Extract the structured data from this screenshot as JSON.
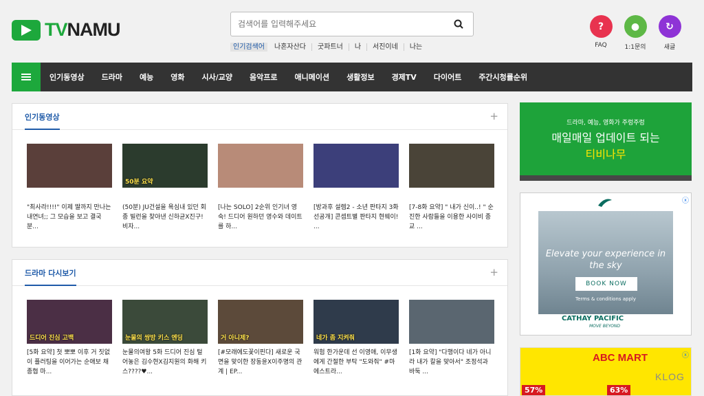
{
  "logo": {
    "tv": "TV",
    "namu": "NAMU"
  },
  "search": {
    "placeholder": "검색어를 입력해주세요"
  },
  "keywords": [
    "인기검색어",
    "나혼자산다",
    "굿파트너",
    "나",
    "서진이네",
    "나는"
  ],
  "topicons": [
    {
      "label": "FAQ",
      "color": "#e8334f",
      "icon": "question-icon",
      "glyph": "?"
    },
    {
      "label": "1:1문의",
      "color": "#5eb846",
      "icon": "chat-icon",
      "glyph": "●"
    },
    {
      "label": "새글",
      "color": "#8e33d6",
      "icon": "refresh-icon",
      "glyph": "↻"
    }
  ],
  "nav": [
    "인기동영상",
    "드라마",
    "예능",
    "영화",
    "시사/교양",
    "음악프로",
    "애니메이션",
    "생활정보",
    "경제TV",
    "다이어트",
    "주간시청률순위"
  ],
  "sections": [
    {
      "title": "인기동영상",
      "plus": "+",
      "cards": [
        {
          "title": "\"최사라!!!!\" 이제 딸까지 만나는 내연녀;; 그 모습을 보고 결국 분...",
          "caption": "",
          "bg": "#5a3f3a"
        },
        {
          "title": "(50분) JU건설을 욕심내 있던 회종 빌런을 찾아낸 신하균X진구! 비자...",
          "caption": "50분 요약",
          "bg": "#2b3b2d"
        },
        {
          "title": "[나는 SOLO] 2순위 인기녀 영숙! 드디어 원하던 영수와 데이트를 하...",
          "caption": "",
          "bg": "#b88b78"
        },
        {
          "title": "[방과후 설렘2 - 소년 판타지 3화 선공개] 콘셉트별 판타지 현웨이! ...",
          "caption": "",
          "bg": "#3c3f7a"
        },
        {
          "title": "[7-8화 요약] \" 내가 신이..! \" 순진한 사람들을 이용한 사이비 종교 ...",
          "caption": "",
          "bg": "#4a4438"
        }
      ]
    },
    {
      "title": "드라마 다시보기",
      "plus": "+",
      "cards": [
        {
          "title": "[5화 요약] 첫 뽀뽀 이후 거 짓없이 플러팅을 이어가는 순애보 채종협 마...",
          "caption": "드디어 진심 고백",
          "bg": "#4b2f45"
        },
        {
          "title": "눈물의여왕 5화 드디어 진심 털어놓은 김수현X김지원의 화해 키스????♥...",
          "caption": "눈물의 쌍방 키스 엔딩",
          "bg": "#3b4a3a"
        },
        {
          "title": "[#모래에도꽃이핀다] 새로운 국면을 맞이한 장동윤X이주명의 관계 | EP...",
          "caption": "거 아니제?",
          "bg": "#5c4a3a"
        },
        {
          "title": "워험 한가운데 선 이영애, 이무생에게 간절한 부탁 \"도와줘\" #마에스트라...",
          "caption": "네가 좀 지켜줘",
          "bg": "#2f3b4b"
        },
        {
          "title": "[1화 요약] \"다행이다 네가 아니라 내가 칼을 맞아서\" 조정석과 바둑 ...",
          "caption": "",
          "bg": "#5a6670"
        }
      ]
    }
  ],
  "ads": {
    "green": {
      "line1": "드라마, 예능, 영화가 주렁주렁",
      "line2": "매일매일 업데이트 되는",
      "line3": "티비나무"
    },
    "cathay": {
      "headline": "Elevate your experience in the sky",
      "button": "BOOK NOW",
      "terms": "Terms & conditions apply",
      "brand": "CATHAY PACIFIC",
      "tagline": "MOVE BEYOND"
    },
    "abc": {
      "brand": "ABC MART",
      "pct1": "57%",
      "pct2": "63%"
    }
  },
  "watermark": "KLOG"
}
